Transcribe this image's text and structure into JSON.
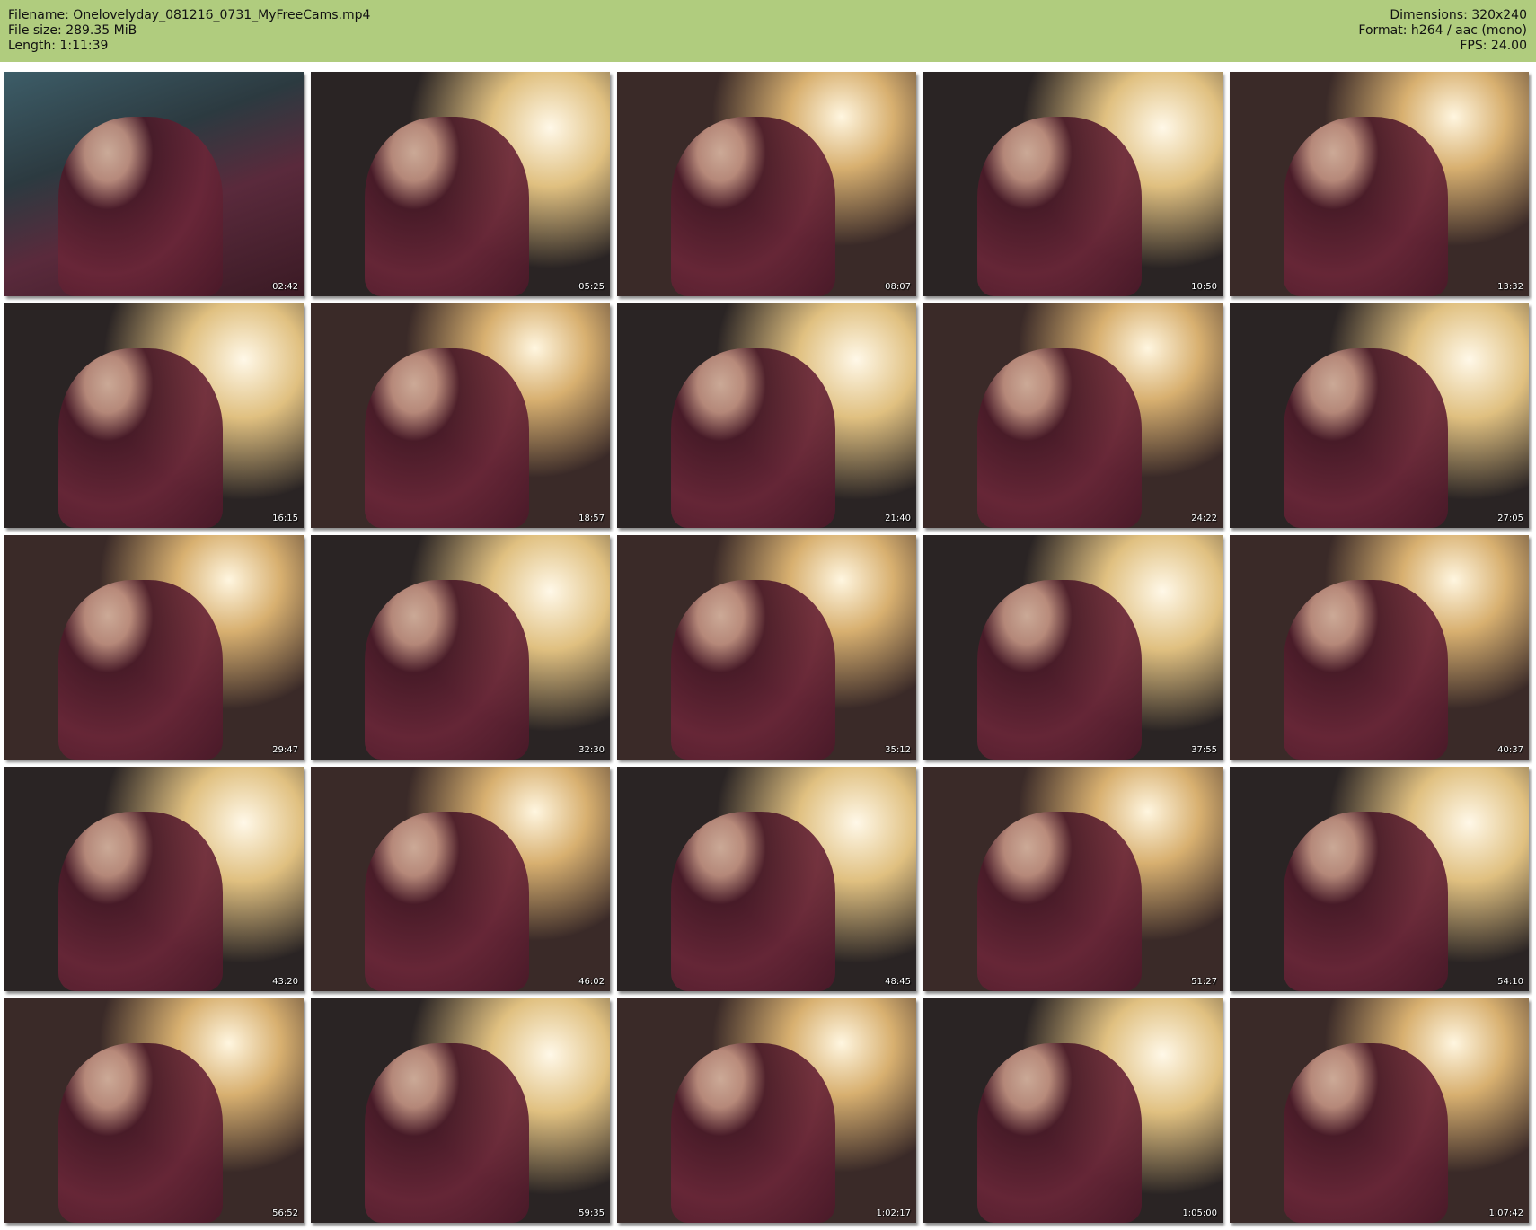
{
  "header": {
    "filename_line": "Filename: Onelovelyday_081216_0731_MyFreeCams.mp4",
    "filesize_line": "File size: 289.35 MiB",
    "length_line": "Length: 1:11:39",
    "dimensions_line": "Dimensions: 320x240",
    "format_line": "Format: h264 / aac (mono)",
    "fps_line": "FPS: 24.00",
    "background_color": "#b0cc7e"
  },
  "thumbnails": [
    {
      "timestamp": "02:42"
    },
    {
      "timestamp": "05:25"
    },
    {
      "timestamp": "08:07"
    },
    {
      "timestamp": "10:50"
    },
    {
      "timestamp": "13:32"
    },
    {
      "timestamp": "16:15"
    },
    {
      "timestamp": "18:57"
    },
    {
      "timestamp": "21:40"
    },
    {
      "timestamp": "24:22"
    },
    {
      "timestamp": "27:05"
    },
    {
      "timestamp": "29:47"
    },
    {
      "timestamp": "32:30"
    },
    {
      "timestamp": "35:12"
    },
    {
      "timestamp": "37:55"
    },
    {
      "timestamp": "40:37"
    },
    {
      "timestamp": "43:20"
    },
    {
      "timestamp": "46:02"
    },
    {
      "timestamp": "48:45"
    },
    {
      "timestamp": "51:27"
    },
    {
      "timestamp": "54:10"
    },
    {
      "timestamp": "56:52"
    },
    {
      "timestamp": "59:35"
    },
    {
      "timestamp": "1:02:17"
    },
    {
      "timestamp": "1:05:00"
    },
    {
      "timestamp": "1:07:42"
    }
  ]
}
